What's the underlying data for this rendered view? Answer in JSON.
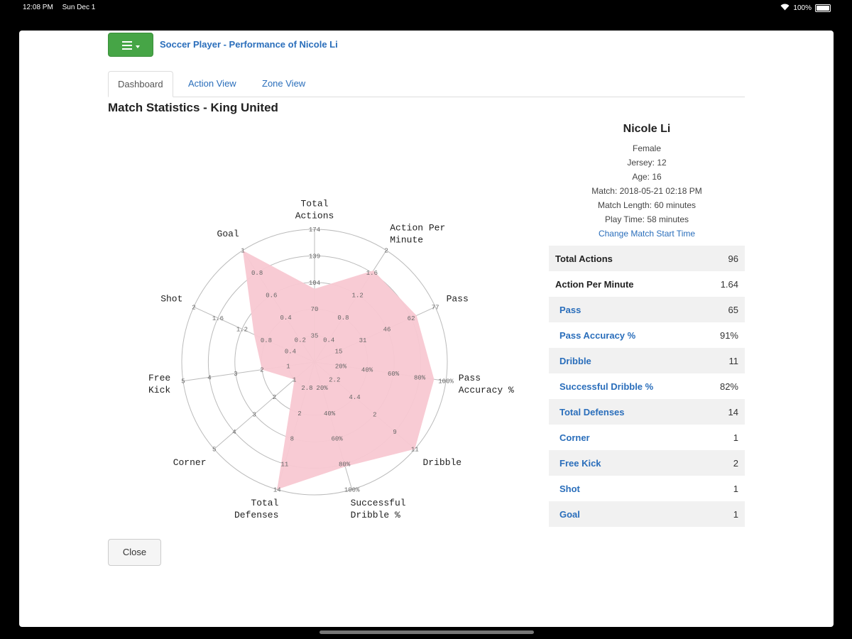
{
  "status_bar": {
    "time": "12:08 PM",
    "date": "Sun Dec 1",
    "battery": "100%"
  },
  "header": {
    "title": "Soccer Player - Performance of Nicole Li",
    "menu_icon": "menu-icon"
  },
  "tabs": [
    {
      "label": "Dashboard",
      "active": true
    },
    {
      "label": "Action View",
      "active": false
    },
    {
      "label": "Zone View",
      "active": false
    }
  ],
  "section_title": "Match Statistics - King United",
  "player": {
    "name": "Nicole Li",
    "gender": "Female",
    "jersey": "Jersey: 12",
    "age": "Age: 16",
    "match": "Match: 2018-05-21 02:18 PM",
    "match_length": "Match Length: 60 minutes",
    "play_time": "Play Time: 58 minutes",
    "change_link": "Change Match Start Time"
  },
  "stats": [
    {
      "label": "Total Actions",
      "value": "96",
      "style": "bold",
      "shaded": true
    },
    {
      "label": "Action Per Minute",
      "value": "1.64",
      "style": "bold",
      "shaded": false
    },
    {
      "label": "Pass",
      "value": "65",
      "style": "sub",
      "shaded": true
    },
    {
      "label": "Pass Accuracy %",
      "value": "91%",
      "style": "sub",
      "shaded": false
    },
    {
      "label": "Dribble",
      "value": "11",
      "style": "sub",
      "shaded": true
    },
    {
      "label": "Successful Dribble %",
      "value": "82%",
      "style": "sub",
      "shaded": false
    },
    {
      "label": "Total Defenses",
      "value": "14",
      "style": "sub",
      "shaded": true
    },
    {
      "label": "Corner",
      "value": "1",
      "style": "sub",
      "shaded": false
    },
    {
      "label": "Free Kick",
      "value": "2",
      "style": "sub",
      "shaded": true
    },
    {
      "label": "Shot",
      "value": "1",
      "style": "sub",
      "shaded": false
    },
    {
      "label": "Goal",
      "value": "1",
      "style": "sub",
      "shaded": true
    }
  ],
  "close_label": "Close",
  "colors": {
    "fill": "#f8c8d2",
    "grid": "#bbbbbb",
    "link": "#2a6ebb",
    "button_green": "#46a546"
  },
  "chart_data": {
    "type": "radar",
    "axes": [
      {
        "label": [
          "Total",
          "Actions"
        ],
        "value": 96,
        "max": 174,
        "ticks": [
          "35",
          "70",
          "104",
          "139",
          "174"
        ]
      },
      {
        "label": [
          "Action Per",
          "Minute"
        ],
        "value": 1.64,
        "max": 2,
        "ticks": [
          "0.4",
          "0.8",
          "1.2",
          "1.6",
          "2"
        ]
      },
      {
        "label": [
          "Pass"
        ],
        "value": 65,
        "max": 77,
        "ticks": [
          "15",
          "31",
          "46",
          "62",
          "77"
        ]
      },
      {
        "label": [
          "Pass",
          "Accuracy %"
        ],
        "value": 91,
        "max": 100,
        "ticks": [
          "20%",
          "40%",
          "60%",
          "80%",
          "100%"
        ]
      },
      {
        "label": [
          "Dribble"
        ],
        "value": 11,
        "max": 11,
        "ticks": [
          "2.2",
          "4.4",
          "2",
          "9",
          "11"
        ]
      },
      {
        "label": [
          "Successful",
          "Dribble %"
        ],
        "value": 82,
        "max": 100,
        "ticks": [
          "20%",
          "40%",
          "60%",
          "80%",
          "100%"
        ]
      },
      {
        "label": [
          "Total",
          "Defenses"
        ],
        "value": 14,
        "max": 14,
        "ticks": [
          "2.8",
          "2",
          "8",
          "11",
          "14"
        ]
      },
      {
        "label": [
          "Corner"
        ],
        "value": 1,
        "max": 5,
        "ticks": [
          "1",
          "2",
          "3",
          "4",
          "5"
        ]
      },
      {
        "label": [
          "Free",
          "Kick"
        ],
        "value": 2,
        "max": 5,
        "ticks": [
          "1",
          "2",
          "3",
          "4",
          "5"
        ]
      },
      {
        "label": [
          "Shot"
        ],
        "value": 1,
        "max": 2,
        "ticks": [
          "0.4",
          "0.8",
          "1.2",
          "1.6",
          "2"
        ]
      },
      {
        "label": [
          "Goal"
        ],
        "value": 1,
        "max": 1,
        "ticks": [
          "0.2",
          "0.4",
          "0.6",
          "0.8",
          "1"
        ]
      }
    ]
  }
}
